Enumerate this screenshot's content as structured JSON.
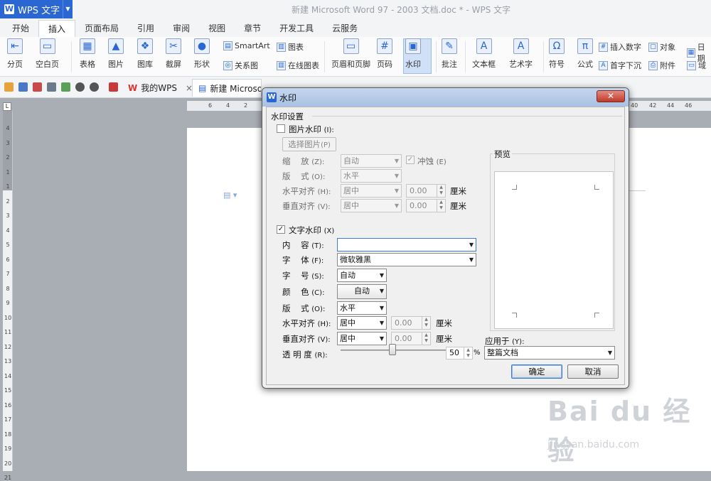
{
  "app": {
    "name": "WPS 文字",
    "window_title": "新建 Microsoft Word 97 - 2003 文档.doc * - WPS 文字"
  },
  "tabs": [
    "开始",
    "插入",
    "页面布局",
    "引用",
    "审阅",
    "视图",
    "章节",
    "开发工具",
    "云服务"
  ],
  "active_tab": "插入",
  "ribbon": {
    "fenye": "分页",
    "kongbaiye": "空白页",
    "biaoge": "表格",
    "tupian": "图片",
    "tuku": "图库",
    "jieping": "截屏",
    "xingzhuang": "形状",
    "smartart": "SmartArt",
    "tubiao": "图表",
    "guanxitu": "关系图",
    "zaixiantubiao": "在线图表",
    "yemeiyejiao": "页眉和页脚",
    "yema": "页码",
    "shuiyin": "水印",
    "pizhu": "批注",
    "wenbenkuang": "文本框",
    "yishuzi": "艺术字",
    "fuhao": "符号",
    "gongshi": "公式",
    "charushuzi": "插入数字",
    "duixiang": "对象",
    "rili": "日期",
    "shouzixiachen": "首字下沉",
    "fujian": "附件",
    "yu": "域"
  },
  "doc_tabs": {
    "mywps": "我的WPS",
    "current": "新建 Microsoft Word 97 - 2003 文档.doc *"
  },
  "ruler_h": [
    "6",
    "4",
    "2",
    "40",
    "42",
    "44",
    "46"
  ],
  "ruler_v": [
    "4",
    "3",
    "2",
    "1",
    "1",
    "2",
    "3",
    "4",
    "5",
    "6",
    "7",
    "8",
    "9",
    "10",
    "11",
    "12",
    "13",
    "14",
    "15",
    "16",
    "17",
    "18",
    "19",
    "20",
    "21"
  ],
  "dialog": {
    "title": "水印",
    "group_title": "水印设置",
    "picture": {
      "checkbox_label": "图片水印",
      "checkbox_key": "(I):",
      "choose_btn": "选择图片",
      "choose_key": "(P)",
      "scale_label": "缩    放",
      "scale_key": "(Z):",
      "scale_value": "自动",
      "washout_label": "冲蚀",
      "washout_key": "(E)",
      "layout_label": "版    式",
      "layout_key": "(O):",
      "layout_value": "水平",
      "halign_label": "水平对齐",
      "halign_key": "(H):",
      "halign_value": "居中",
      "halign_offset": "0.00",
      "valign_label": "垂直对齐",
      "valign_key": "(V):",
      "valign_value": "居中",
      "valign_offset": "0.00",
      "unit": "厘米"
    },
    "text": {
      "checkbox_label": "文字水印",
      "checkbox_key": "(X)",
      "content_label": "内    容",
      "content_key": "(T):",
      "content_value": "",
      "font_label": "字    体",
      "font_key": "(F):",
      "font_value": "微软雅黑",
      "size_label": "字    号",
      "size_key": "(S):",
      "size_value": "自动",
      "color_label": "颜    色",
      "color_key": "(C):",
      "color_value": "自动",
      "layout_label": "版    式",
      "layout_key": "(O):",
      "layout_value": "水平",
      "halign_label": "水平对齐",
      "halign_key": "(H):",
      "halign_value": "居中",
      "halign_offset": "0.00",
      "valign_label": "垂直对齐",
      "valign_key": "(V):",
      "valign_value": "居中",
      "valign_offset": "0.00",
      "unit": "厘米",
      "transparency_label": "透 明 度",
      "transparency_key": "(R):",
      "transparency_value": "50",
      "transparency_unit": "%"
    },
    "preview_label": "预览",
    "apply_label": "应用于",
    "apply_key": "(Y):",
    "apply_value": "整篇文档",
    "ok": "确定",
    "cancel": "取消"
  },
  "watermark": {
    "brand": "Bai du 经验",
    "url": "jingyan.baidu.com"
  }
}
